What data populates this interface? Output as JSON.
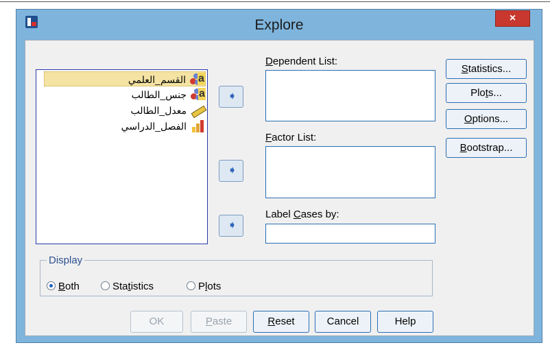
{
  "window": {
    "title": "Explore",
    "close_label": "×"
  },
  "variables": [
    {
      "label": "القسم_العلمي",
      "icon": "nominal-icon",
      "selected": true
    },
    {
      "label": "جنس_الطالب",
      "icon": "nominal-icon",
      "selected": false
    },
    {
      "label": "معدل_الطالب",
      "icon": "scale-icon",
      "selected": false
    },
    {
      "label": "الفصل_الدراسي",
      "icon": "ordinal-icon",
      "selected": false
    }
  ],
  "nominal_glyph": "a",
  "arrow_glyph": "➧",
  "fields": {
    "dependent": {
      "u": "D",
      "rest": "ependent List:"
    },
    "factor": {
      "u": "F",
      "rest": "actor List:"
    },
    "label_cases": {
      "pre": "Label ",
      "u": "C",
      "rest": "ases by:"
    }
  },
  "side_buttons": {
    "statistics": {
      "u": "S",
      "rest": "tatistics..."
    },
    "plots": {
      "pre": "Plo",
      "u": "t",
      "rest": "s..."
    },
    "options": {
      "u": "O",
      "rest": "ptions..."
    },
    "bootstrap": {
      "u": "B",
      "rest": "ootstrap..."
    }
  },
  "display": {
    "title": "Display",
    "both": {
      "u": "B",
      "rest": "oth"
    },
    "statistics": {
      "pre": "Sta",
      "u": "t",
      "rest": "istics"
    },
    "plots": {
      "pre": "P",
      "u": "l",
      "rest": "ots"
    },
    "selected": "both"
  },
  "bottom_buttons": {
    "ok": "OK",
    "paste": {
      "u": "P",
      "rest": "aste"
    },
    "reset": {
      "u": "R",
      "rest": "eset"
    },
    "cancel": "Cancel",
    "help": "Help"
  }
}
